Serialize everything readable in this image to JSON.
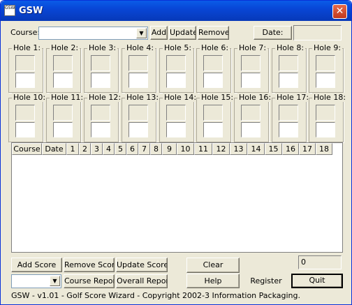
{
  "window": {
    "title": "GSW",
    "icon": "GSW"
  },
  "toolbar": {
    "course_label": "Course:",
    "course_value": "",
    "add": "Add",
    "update": "Update",
    "remove": "Remove",
    "date_button": "Date:",
    "date_value": ""
  },
  "holes": [
    "Hole 1:",
    "Hole 2:",
    "Hole 3:",
    "Hole 4:",
    "Hole 5:",
    "Hole 6:",
    "Hole 7:",
    "Hole 8:",
    "Hole 9:",
    "Hole 10:",
    "Hole 11:",
    "Hole 12:",
    "Hole 13:",
    "Hole 14:",
    "Hole 15:",
    "Hole 16:",
    "Hole 17:",
    "Hole 18:"
  ],
  "table": {
    "columns": [
      "Course",
      "Date",
      "1",
      "2",
      "3",
      "4",
      "5",
      "6",
      "7",
      "8",
      "9",
      "10",
      "11",
      "12",
      "13",
      "14",
      "15",
      "16",
      "17",
      "18"
    ],
    "rows": []
  },
  "buttons": {
    "add_score": "Add Score",
    "remove_score": "Remove Score",
    "update_score": "Update Score",
    "clear": "Clear",
    "course_report": "Course Report",
    "overall_report": "Overall Report",
    "help": "Help",
    "register": "Register",
    "quit": "Quit"
  },
  "total_value": "0",
  "report_select_value": "",
  "status": "GSW - v1.01 - Golf Score Wizard - Copyright 2002-3 Information Packaging."
}
